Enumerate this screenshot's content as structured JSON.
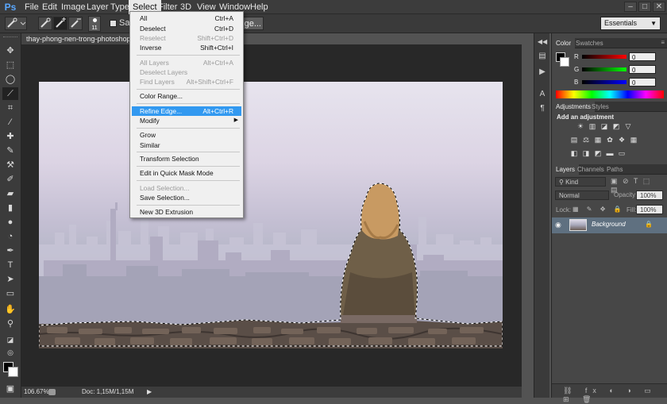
{
  "app": {
    "logo": "Ps"
  },
  "menubar": {
    "items": [
      "File",
      "Edit",
      "Image",
      "Layer",
      "Type",
      "Select",
      "Filter",
      "3D",
      "View",
      "Window",
      "Help"
    ],
    "active": "Select",
    "window_controls": [
      "–",
      "□",
      "✕"
    ]
  },
  "options_bar": {
    "brush_size": "11",
    "sample_label": "Sam",
    "refine_label": "Refine Edge...",
    "workspace": "Essentials"
  },
  "document": {
    "tab_title": "thay-phong-nen-trong-photoshop.jpg",
    "zoom": "106.67%",
    "doc_info": "Doc: 1,15M/1,15M"
  },
  "select_menu": {
    "items": [
      {
        "label": "All",
        "shortcut": "Ctrl+A",
        "disabled": false
      },
      {
        "label": "Deselect",
        "shortcut": "Ctrl+D",
        "disabled": false
      },
      {
        "label": "Reselect",
        "shortcut": "Shift+Ctrl+D",
        "disabled": true
      },
      {
        "label": "Inverse",
        "shortcut": "Shift+Ctrl+I",
        "disabled": false
      },
      {
        "label": "All Layers",
        "shortcut": "Alt+Ctrl+A",
        "disabled": true
      },
      {
        "label": "Deselect Layers",
        "shortcut": "",
        "disabled": true
      },
      {
        "label": "Find Layers",
        "shortcut": "Alt+Shift+Ctrl+F",
        "disabled": true
      },
      {
        "label": "Color Range...",
        "shortcut": "",
        "disabled": false
      },
      {
        "label": "Refine Edge...",
        "shortcut": "Alt+Ctrl+R",
        "disabled": false,
        "highlighted": true
      },
      {
        "label": "Modify",
        "shortcut": "",
        "disabled": false,
        "submenu": true
      },
      {
        "label": "Grow",
        "shortcut": "",
        "disabled": false
      },
      {
        "label": "Similar",
        "shortcut": "",
        "disabled": false
      },
      {
        "label": "Transform Selection",
        "shortcut": "",
        "disabled": false
      },
      {
        "label": "Edit in Quick Mask Mode",
        "shortcut": "",
        "disabled": false
      },
      {
        "label": "Load Selection...",
        "shortcut": "",
        "disabled": true
      },
      {
        "label": "Save Selection...",
        "shortcut": "",
        "disabled": false
      },
      {
        "label": "New 3D Extrusion",
        "shortcut": "",
        "disabled": false
      }
    ]
  },
  "color_panel": {
    "tabs": [
      "Color",
      "Swatches"
    ],
    "channels": [
      {
        "label": "R",
        "value": "0"
      },
      {
        "label": "G",
        "value": "0"
      },
      {
        "label": "B",
        "value": "0"
      }
    ]
  },
  "adjustments_panel": {
    "tabs": [
      "Adjustments",
      "Styles"
    ],
    "heading": "Add an adjustment",
    "icons_row1": [
      "☀",
      "▥",
      "◪",
      "◩",
      "▽"
    ],
    "icons_row2": [
      "▤",
      "⚖",
      "▦",
      "✿",
      "❖",
      "▦"
    ],
    "icons_row3": [
      "◧",
      "◨",
      "◩",
      "▬",
      "▭"
    ]
  },
  "layers_panel": {
    "tabs": [
      "Layers",
      "Channels",
      "Paths"
    ],
    "kind": "Kind",
    "blend_mode": "Normal",
    "opacity_label": "Opacity:",
    "opacity_value": "100%",
    "lock_label": "Lock:",
    "fill_label": "Fill:",
    "fill_value": "100%",
    "layer_name": "Background"
  },
  "colors": {
    "selection_highlight": "#3299f0",
    "ui_dark": "#3c3c3c",
    "panel": "#474747"
  }
}
